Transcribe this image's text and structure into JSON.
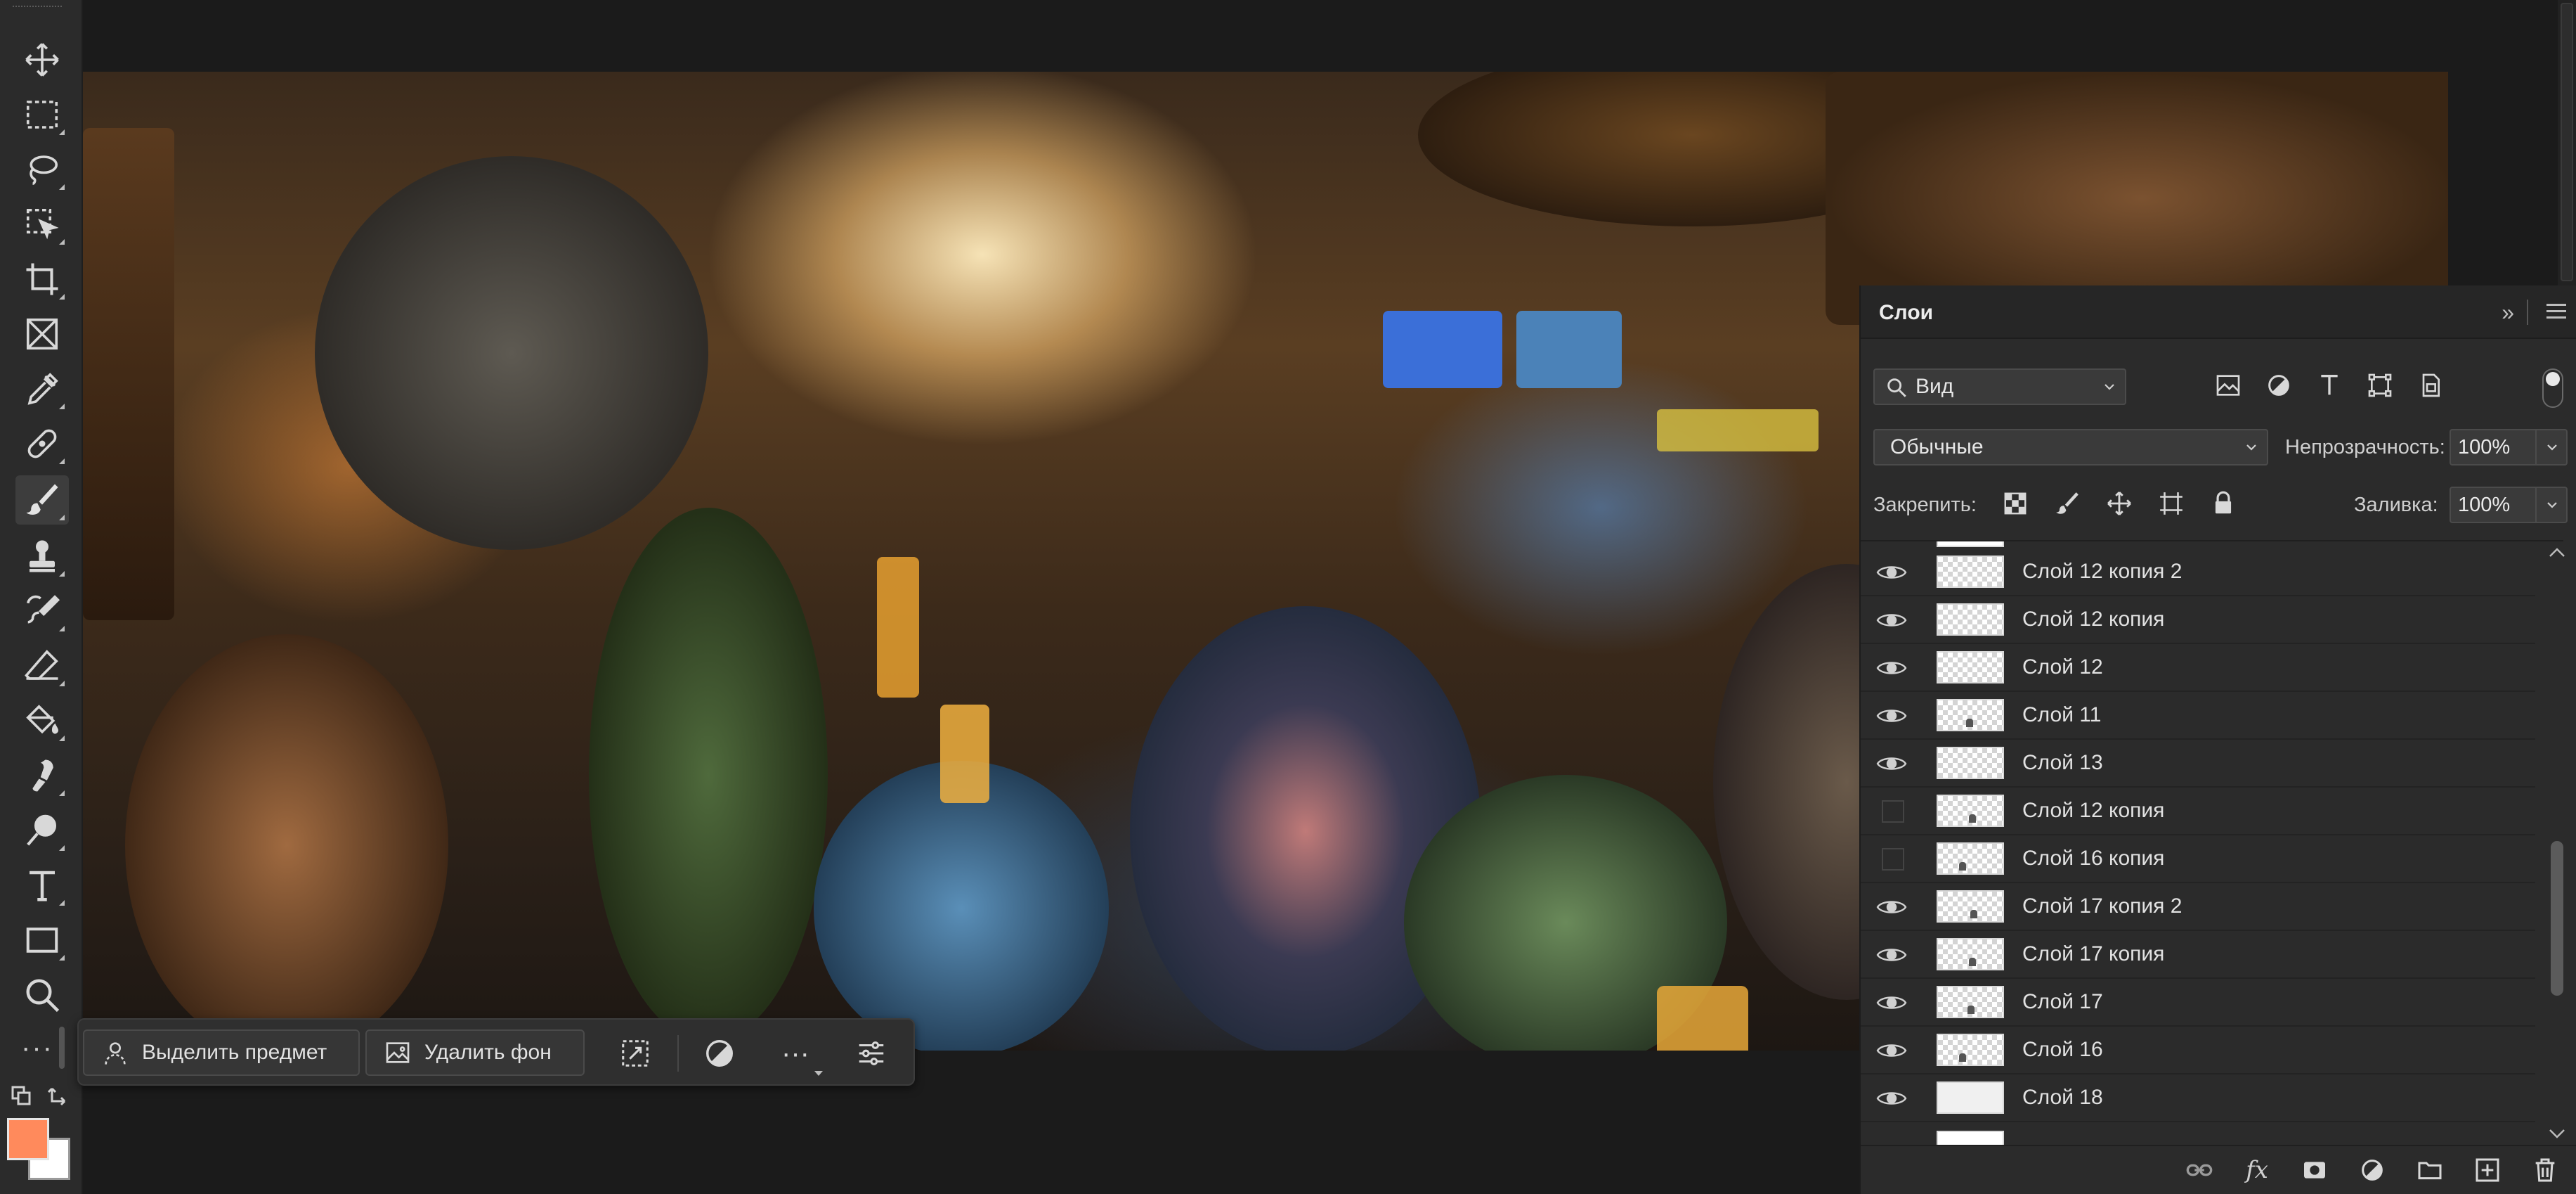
{
  "toolbar": {
    "tools": [
      {
        "name": "move-icon"
      },
      {
        "name": "marquee-icon"
      },
      {
        "name": "lasso-icon"
      },
      {
        "name": "object-select-icon"
      },
      {
        "name": "crop-icon"
      },
      {
        "name": "frame-icon"
      },
      {
        "name": "eyedropper-icon"
      },
      {
        "name": "healing-brush-icon"
      },
      {
        "name": "brush-icon",
        "active": true
      },
      {
        "name": "clone-stamp-icon"
      },
      {
        "name": "history-brush-icon"
      },
      {
        "name": "eraser-icon"
      },
      {
        "name": "paint-bucket-icon"
      },
      {
        "name": "smudge-icon"
      },
      {
        "name": "dodge-icon"
      },
      {
        "name": "type-icon"
      },
      {
        "name": "rectangle-icon"
      },
      {
        "name": "zoom-icon"
      }
    ],
    "more_label": "···",
    "foreground_color": "#ff8a5c",
    "background_color": "#ffffff"
  },
  "taskbar": {
    "select_subject_label": "Выделить предмет",
    "remove_bg_label": "Удалить фон",
    "more_label": "···"
  },
  "layers_panel": {
    "title": "Слои",
    "filter_kind": "Вид",
    "blend_mode": "Обычные",
    "opacity_label": "Непрозрачность:",
    "opacity_value": "100%",
    "lock_label": "Закрепить:",
    "fill_label": "Заливка:",
    "fill_value": "100%",
    "layers": [
      {
        "name": "Слой 12 копия 2",
        "visible": true
      },
      {
        "name": "Слой 12 копия",
        "visible": true
      },
      {
        "name": "Слой 12",
        "visible": true
      },
      {
        "name": "Слой 11",
        "visible": true
      },
      {
        "name": "Слой 13",
        "visible": true
      },
      {
        "name": "Слой 12 копия",
        "visible": false
      },
      {
        "name": "Слой 16 копия",
        "visible": false
      },
      {
        "name": "Слой 17 копия 2",
        "visible": true
      },
      {
        "name": "Слой 17 копия",
        "visible": true
      },
      {
        "name": "Слой 17",
        "visible": true
      },
      {
        "name": "Слой 16",
        "visible": true
      },
      {
        "name": "Слой 18",
        "visible": true
      }
    ],
    "footer_fx_label": "fx"
  },
  "colors": {
    "panel_bg": "#2b2b2b",
    "app_bg": "#1b1b1b",
    "foreground": "#ff8a5c"
  }
}
